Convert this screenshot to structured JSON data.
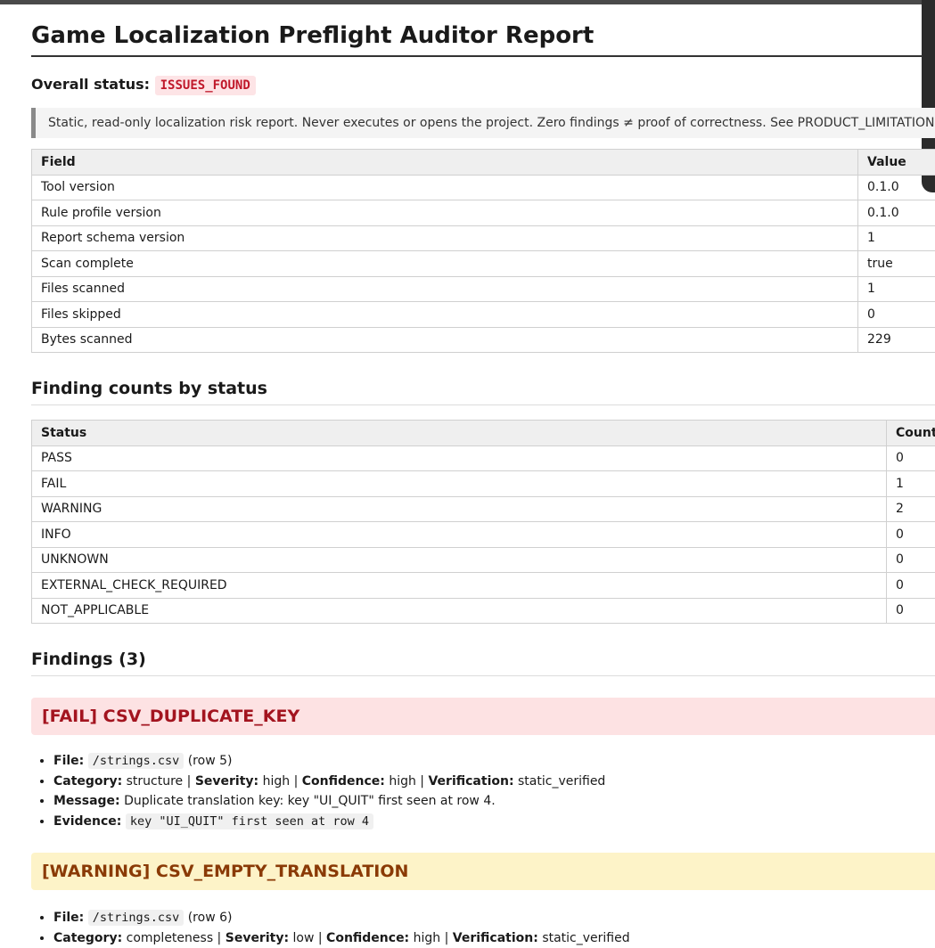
{
  "report": {
    "title": "Game Localization Preflight Auditor Report",
    "overall_label": "Overall status:",
    "overall_status": "ISSUES_FOUND",
    "notice": "Static, read-only localization risk report. Never executes or opens the project. Zero findings ≠ proof of correctness. See PRODUCT_LIMITATIONS.md."
  },
  "meta_table": {
    "headers": [
      "Field",
      "Value"
    ],
    "rows": [
      [
        "Tool version",
        "0.1.0"
      ],
      [
        "Rule profile version",
        "0.1.0"
      ],
      [
        "Report schema version",
        "1"
      ],
      [
        "Scan complete",
        "true"
      ],
      [
        "Files scanned",
        "1"
      ],
      [
        "Files skipped",
        "0"
      ],
      [
        "Bytes scanned",
        "229"
      ]
    ]
  },
  "counts": {
    "heading": "Finding counts by status",
    "headers": [
      "Status",
      "Count"
    ],
    "rows": [
      [
        "PASS",
        "0"
      ],
      [
        "FAIL",
        "1"
      ],
      [
        "WARNING",
        "2"
      ],
      [
        "INFO",
        "0"
      ],
      [
        "UNKNOWN",
        "0"
      ],
      [
        "EXTERNAL_CHECK_REQUIRED",
        "0"
      ],
      [
        "NOT_APPLICABLE",
        "0"
      ]
    ]
  },
  "findings": {
    "heading": "Findings (3)",
    "labels": {
      "file": "File:",
      "category": "Category:",
      "severity": "Severity:",
      "confidence": "Confidence:",
      "verification": "Verification:",
      "message": "Message:",
      "evidence": "Evidence:",
      "sep": " | "
    },
    "items": [
      {
        "title": "[FAIL] CSV_DUPLICATE_KEY",
        "file": "/strings.csv",
        "row": "(row 5)",
        "category": "structure",
        "severity": "high",
        "confidence": "high",
        "verification": "static_verified",
        "message": "Duplicate translation key: key \"UI_QUIT\" first seen at row 4.",
        "evidence": "key \"UI_QUIT\" first seen at row 4"
      },
      {
        "title": "[WARNING] CSV_EMPTY_TRANSLATION",
        "file": "/strings.csv",
        "row": "(row 6)",
        "category": "completeness",
        "severity": "low",
        "confidence": "high",
        "verification": "static_verified"
      }
    ]
  },
  "colors": {
    "fail_bg": "#fde2e3",
    "fail_text": "#a3141f",
    "warn_bg": "#fdf3c8",
    "warn_text": "#8a3a06",
    "badge_text": "#c0182a"
  }
}
